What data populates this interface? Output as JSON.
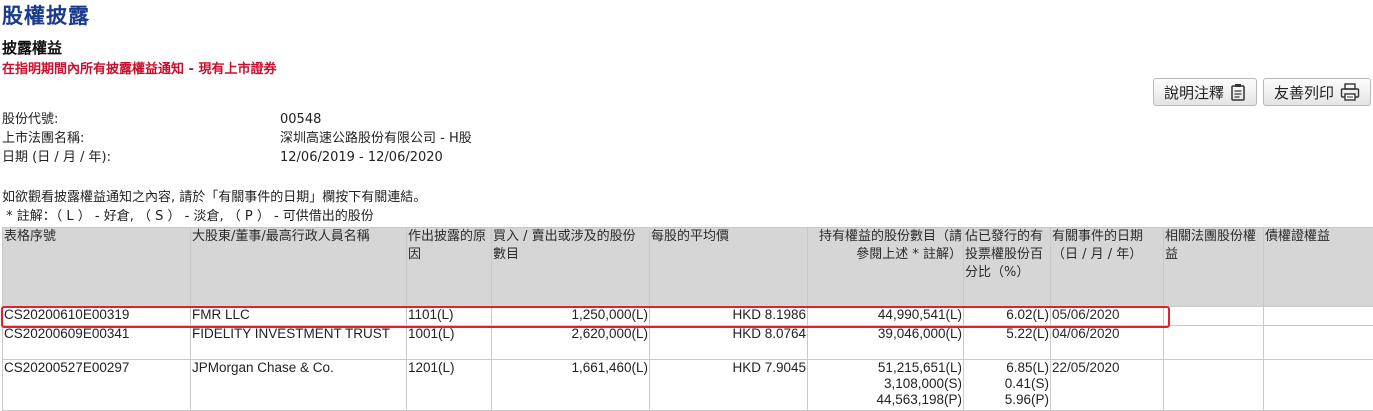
{
  "header": {
    "title": "股權披露",
    "section_title": "披露權益",
    "subtitle": "在指明期間內所有披露權益通知 - 現有上市證券"
  },
  "toolbar": {
    "explain_label": "說明注釋",
    "print_label": "友善列印"
  },
  "info": {
    "stock_code_label": "股份代號:",
    "stock_code": "00548",
    "company_label": "上市法團名稱:",
    "company": "深圳高速公路股份有限公司 - H股",
    "date_label": "日期 (日 / 月 / 年):",
    "date_range": "12/06/2019 - 12/06/2020"
  },
  "notes": {
    "line1": "如欲觀看披露權益通知之內容, 請於「有關事件的日期」欄按下有關連結。",
    "line2": " * 註解：（ L ） - 好倉, （ S ） - 淡倉, （ P ） - 可供借出的股份"
  },
  "table": {
    "headers": [
      "表格序號",
      "大股東/董事/最高行政人員名稱",
      "作出披露的原因",
      "買入 / 賣出或涉及的股份數目",
      "每股的平均價",
      "持有權益的股份數目（請參閱上述 * 註解）",
      "佔已發行的有投票權股份百分比（%）",
      "有關事件的日期（日 / 月 / 年）",
      "相關法團股份權益",
      "債權證權益"
    ],
    "rows": [
      {
        "form_no": "CS20200610E00319",
        "name": "FMR LLC",
        "reason": "1101(L)",
        "shares_traded": "1,250,000(L)",
        "avg_price": "HKD 8.1986",
        "holdings": [
          "44,990,541(L)"
        ],
        "percent": [
          "6.02(L)"
        ],
        "event_date": "05/06/2020"
      },
      {
        "form_no": "CS20200609E00341",
        "name": "FIDELITY INVESTMENT TRUST",
        "reason": "1001(L)",
        "shares_traded": "2,620,000(L)",
        "avg_price": "HKD 8.0764",
        "holdings": [
          "39,046,000(L)"
        ],
        "percent": [
          "5.22(L)"
        ],
        "event_date": "04/06/2020"
      },
      {
        "form_no": "CS20200527E00297",
        "name": "JPMorgan Chase & Co.",
        "reason": "1201(L)",
        "shares_traded": "1,661,460(L)",
        "avg_price": "HKD 7.9045",
        "holdings": [
          "51,215,651(L)",
          "3,108,000(S)",
          "44,563,198(P)"
        ],
        "percent": [
          "6.85(L)",
          "0.41(S)",
          "5.96(P)"
        ],
        "event_date": "22/05/2020"
      }
    ]
  },
  "colors": {
    "title": "#1a3a8c",
    "subtitle": "#c8102e",
    "highlight": "#e2222a",
    "header_bg": "#d6d6d6"
  }
}
